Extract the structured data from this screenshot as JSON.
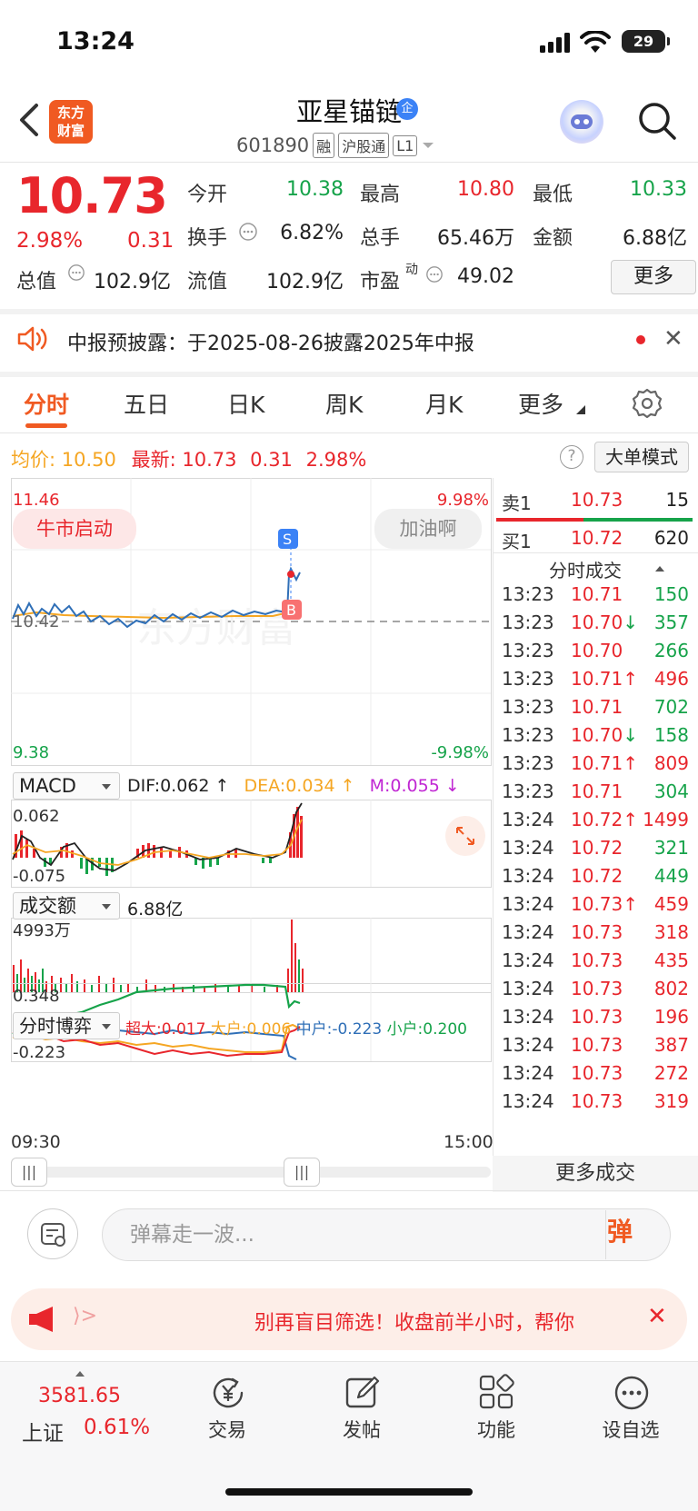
{
  "status_bar": {
    "time": "13:24",
    "battery": "29"
  },
  "header": {
    "logo_text_1": "东方",
    "logo_text_2": "财富",
    "stock_name": "亚星锚链",
    "verified_badge": "企",
    "stock_code": "601890",
    "tags": [
      "融",
      "沪股通",
      "L1"
    ]
  },
  "quote": {
    "price": "10.73",
    "change_pct": "2.98%",
    "change": "0.31",
    "fields": [
      {
        "label": "今开",
        "value": "10.38",
        "color": "#16a34a"
      },
      {
        "label": "最高",
        "value": "10.80",
        "color": "#e8262c"
      },
      {
        "label": "最低",
        "value": "10.33",
        "color": "#16a34a"
      },
      {
        "label": "换手",
        "value": "6.82%",
        "color": "#222222"
      },
      {
        "label": "总手",
        "value": "65.46万",
        "color": "#222222"
      },
      {
        "label": "金额",
        "value": "6.88亿",
        "color": "#222222"
      },
      {
        "label": "总值",
        "value": "102.9亿",
        "color": "#222222"
      },
      {
        "label": "流值",
        "value": "102.9亿",
        "color": "#222222"
      },
      {
        "label": "市盈",
        "value": "49.02",
        "color": "#222222"
      }
    ],
    "pe_superscript": "动",
    "more_label": "更多"
  },
  "notice": {
    "text": "中报预披露：于2025-08-26披露2025年中报"
  },
  "tabs": [
    "分时",
    "五日",
    "日K",
    "周K",
    "月K",
    "更多"
  ],
  "chart_header": {
    "avg_label": "均价:",
    "avg_value": "10.50",
    "latest_label": "最新:",
    "latest_value": "10.73",
    "latest_change": "0.31",
    "latest_pct": "2.98%",
    "help": "?",
    "big_order_mode": "大单模式"
  },
  "intraday": {
    "y_top": "11.46",
    "y_mid": "10.42",
    "y_bottom": "9.38",
    "pct_top": "9.98%",
    "pct_bottom": "-9.98%",
    "bull_pill": "牛市启动",
    "cheer_pill": "加油啊",
    "sell_marker": "S",
    "buy_marker": "B",
    "watermark": "东方财富"
  },
  "macd": {
    "selector": "MACD",
    "dif": "DIF:0.062 ↑",
    "dea": "DEA:0.034 ↑",
    "m": "M:0.055 ↓",
    "top": "0.062",
    "bottom": "-0.075"
  },
  "volume": {
    "selector": "成交额",
    "total": "6.88亿",
    "max": "4993万"
  },
  "game": {
    "selector": "分时博弈",
    "super": "超大:0.017",
    "big": "大户:0.006",
    "mid": "中户:-0.223",
    "small": "小户:0.200",
    "top": "0.348",
    "bottom": "-0.223",
    "time_start": "09:30",
    "time_end": "15:00"
  },
  "order_book": {
    "sell1_label": "卖1",
    "sell1_price": "10.73",
    "sell1_vol": "15",
    "buy1_label": "买1",
    "buy1_price": "10.72",
    "buy1_vol": "620"
  },
  "trades": {
    "title": "分时成交",
    "more": "更多成交",
    "rows": [
      {
        "t": "13:23",
        "p": "10.71",
        "a": "",
        "v": "150",
        "c": "#16a34a"
      },
      {
        "t": "13:23",
        "p": "10.70",
        "a": "↓",
        "v": "357",
        "c": "#16a34a"
      },
      {
        "t": "13:23",
        "p": "10.70",
        "a": "",
        "v": "266",
        "c": "#16a34a"
      },
      {
        "t": "13:23",
        "p": "10.71",
        "a": "↑",
        "v": "496",
        "c": "#e8262c"
      },
      {
        "t": "13:23",
        "p": "10.71",
        "a": "",
        "v": "702",
        "c": "#16a34a"
      },
      {
        "t": "13:23",
        "p": "10.70",
        "a": "↓",
        "v": "158",
        "c": "#16a34a"
      },
      {
        "t": "13:23",
        "p": "10.71",
        "a": "↑",
        "v": "809",
        "c": "#e8262c"
      },
      {
        "t": "13:23",
        "p": "10.71",
        "a": "",
        "v": "304",
        "c": "#16a34a"
      },
      {
        "t": "13:24",
        "p": "10.72",
        "a": "↑",
        "v": "1499",
        "c": "#e8262c"
      },
      {
        "t": "13:24",
        "p": "10.72",
        "a": "",
        "v": "321",
        "c": "#16a34a"
      },
      {
        "t": "13:24",
        "p": "10.72",
        "a": "",
        "v": "449",
        "c": "#16a34a"
      },
      {
        "t": "13:24",
        "p": "10.73",
        "a": "↑",
        "v": "459",
        "c": "#e8262c"
      },
      {
        "t": "13:24",
        "p": "10.73",
        "a": "",
        "v": "318",
        "c": "#e8262c"
      },
      {
        "t": "13:24",
        "p": "10.73",
        "a": "",
        "v": "435",
        "c": "#e8262c"
      },
      {
        "t": "13:24",
        "p": "10.73",
        "a": "",
        "v": "802",
        "c": "#e8262c"
      },
      {
        "t": "13:24",
        "p": "10.73",
        "a": "",
        "v": "196",
        "c": "#e8262c"
      },
      {
        "t": "13:24",
        "p": "10.73",
        "a": "",
        "v": "387",
        "c": "#e8262c"
      },
      {
        "t": "13:24",
        "p": "10.73",
        "a": "",
        "v": "272",
        "c": "#e8262c"
      },
      {
        "t": "13:24",
        "p": "10.73",
        "a": "",
        "v": "319",
        "c": "#e8262c"
      }
    ]
  },
  "danmaku": {
    "placeholder": "弹幕走一波...",
    "send": "弹"
  },
  "promo": {
    "text": "别再盲目筛选！收盘前半小时，帮你"
  },
  "bottom_nav": {
    "index_value": "3581.65",
    "index_name": "上证",
    "index_pct": "0.61%",
    "items": [
      "交易",
      "发帖",
      "功能",
      "设自选"
    ]
  },
  "colors": {
    "up": "#e8262c",
    "down": "#16a34a",
    "brand": "#f05a22",
    "avg": "#f5a623",
    "price_line": "#2f6fb7"
  }
}
